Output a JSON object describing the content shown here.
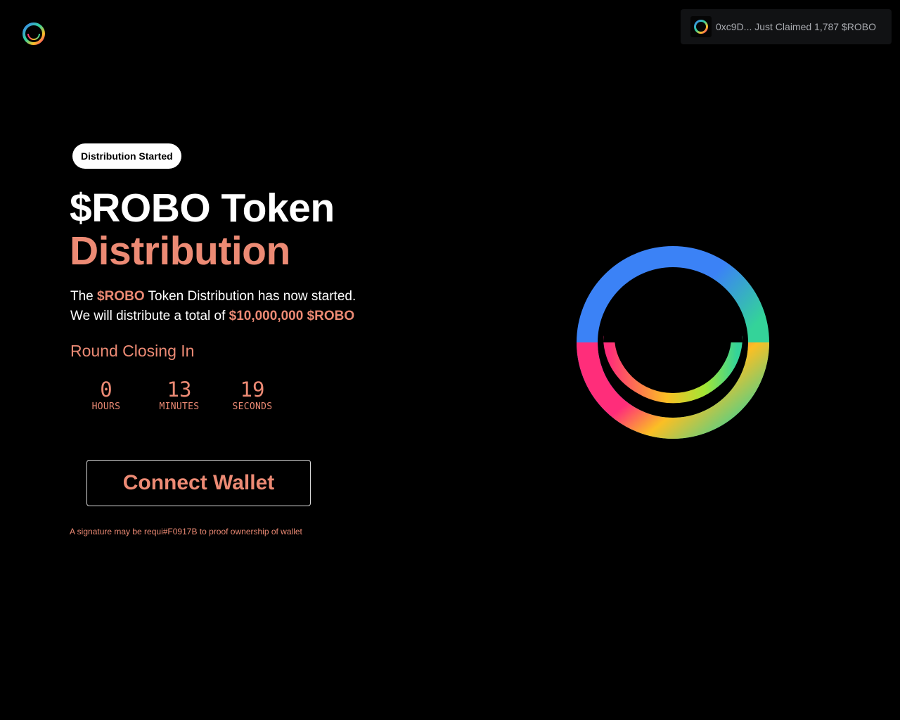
{
  "header": {
    "logo_icon": "ring-logo-icon"
  },
  "toast": {
    "icon": "ring-logo-icon",
    "text": "0xc9D... Just Claimed 1,787 $ROBO"
  },
  "hero": {
    "status_badge": "Distribution Started",
    "title_line1": "$ROBO Token",
    "title_line2": "Distribution",
    "desc_part1": "The ",
    "desc_token": "$ROBO",
    "desc_part2": " Token Distribution has now started.",
    "desc_part3": "We will distribute a total of ",
    "desc_total": "$10,000,000 $ROBO",
    "round_label": "Round Closing In",
    "countdown": {
      "hours": "0",
      "hours_label": "HOURS",
      "minutes": "13",
      "minutes_label": "MINUTES",
      "seconds": "19",
      "seconds_label": "SECONDS"
    },
    "connect_label": "Connect Wallet",
    "signature_note": "A signature may be requi#F0917B to proof ownership of wallet"
  },
  "colors": {
    "background": "#000000",
    "accent": "#ec8a74",
    "toast_bg": "#111214",
    "ring_blue": "#3b82f6",
    "ring_green": "#34d399",
    "ring_pink": "#ff2d7a",
    "ring_yellow": "#fbbf24"
  }
}
